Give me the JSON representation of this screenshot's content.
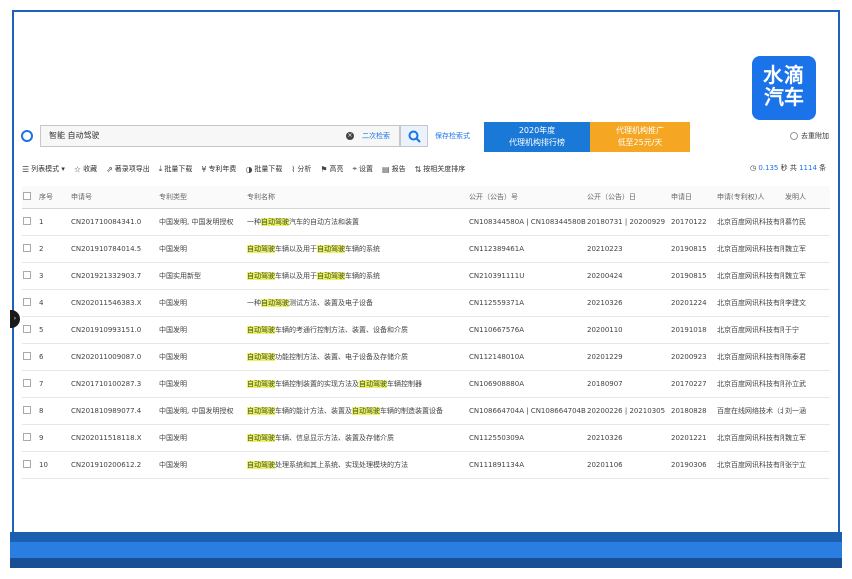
{
  "logo": {
    "line1": "水滴",
    "line2": "汽车"
  },
  "search": {
    "query": "智能 自动驾驶",
    "secondary_search_label": "二次检索",
    "save_label": "保存检索式"
  },
  "banner": {
    "left_line1": "2020年度",
    "left_line2": "代理机构排行榜",
    "right_line1": "代理机构推广",
    "right_line2": "低至25元/天"
  },
  "family_dedup_label": "去重附加",
  "toolbar": {
    "items": [
      {
        "icon": "list-icon",
        "label": "列表模式 ▾"
      },
      {
        "icon": "star-icon",
        "label": "收藏"
      },
      {
        "icon": "share-icon",
        "label": "著录项导出"
      },
      {
        "icon": "download-icon",
        "label": "批量下载"
      },
      {
        "icon": "yen-icon",
        "label": "专利年费"
      },
      {
        "icon": "contrast-icon",
        "label": "批量下载"
      },
      {
        "icon": "chart-icon",
        "label": "分析"
      },
      {
        "icon": "flag-icon",
        "label": "高亮"
      },
      {
        "icon": "pin-icon",
        "label": "设置"
      },
      {
        "icon": "report-icon",
        "label": "报告"
      },
      {
        "icon": "sort-icon",
        "label": "按相关度排序"
      }
    ]
  },
  "stats": {
    "time": "0.135",
    "time_unit": "秒 共",
    "count": "1114",
    "count_unit": "条"
  },
  "table": {
    "headers": [
      "序号",
      "申请号",
      "专利类型",
      "专利名称",
      "公开（公告）号",
      "公开（公告）日",
      "申请日",
      "申请(专利权)人",
      "发明人"
    ],
    "rows": [
      {
        "no": "1",
        "appno": "CN201710084341.0",
        "type": "中国发明, 中国发明授权",
        "title_parts": [
          {
            "t": "一种"
          },
          {
            "t": "自动驾驶",
            "h": true
          },
          {
            "t": "汽车的自动方法和装置"
          }
        ],
        "pubno": "CN108344580A | CN108344580B",
        "pubdate": "20180731 | 20200929",
        "appdate": "20170122",
        "applicant": "北京百度网讯科技有限公司",
        "inventor": "慕竹民"
      },
      {
        "no": "2",
        "appno": "CN201910784014.5",
        "type": "中国发明",
        "title_parts": [
          {
            "t": "自动驾驶",
            "h": true
          },
          {
            "t": "车辆以及用于"
          },
          {
            "t": "自动驾驶",
            "h": true
          },
          {
            "t": "车辆的系统"
          }
        ],
        "pubno": "CN112389461A",
        "pubdate": "20210223",
        "appdate": "20190815",
        "applicant": "北京百度网讯科技有限公司",
        "inventor": "魏立军"
      },
      {
        "no": "3",
        "appno": "CN201921332903.7",
        "type": "中国实用新型",
        "title_parts": [
          {
            "t": "自动驾驶",
            "h": true
          },
          {
            "t": "车辆以及用于"
          },
          {
            "t": "自动驾驶",
            "h": true
          },
          {
            "t": "车辆的系统"
          }
        ],
        "pubno": "CN210391111U",
        "pubdate": "20200424",
        "appdate": "20190815",
        "applicant": "北京百度网讯科技有限公司",
        "inventor": "魏立军"
      },
      {
        "no": "4",
        "appno": "CN202011546383.X",
        "type": "中国发明",
        "title_parts": [
          {
            "t": "一种"
          },
          {
            "t": "自动驾驶",
            "h": true
          },
          {
            "t": "测试方法、装置及电子设备"
          }
        ],
        "pubno": "CN112559371A",
        "pubdate": "20210326",
        "appdate": "20201224",
        "applicant": "北京百度网讯科技有限公司",
        "inventor": "李建文"
      },
      {
        "no": "5",
        "appno": "CN201910993151.0",
        "type": "中国发明",
        "title_parts": [
          {
            "t": "自动驾驶",
            "h": true
          },
          {
            "t": "车辆的考通行控制方法、装置、设备和介质"
          }
        ],
        "pubno": "CN110667576A",
        "pubdate": "20200110",
        "appdate": "20191018",
        "applicant": "北京百度网讯科技有限公司",
        "inventor": "于宁"
      },
      {
        "no": "6",
        "appno": "CN202011009087.0",
        "type": "中国发明",
        "title_parts": [
          {
            "t": "自动驾驶",
            "h": true
          },
          {
            "t": "功能控制方法、装置、电子设备及存储介质"
          }
        ],
        "pubno": "CN112148010A",
        "pubdate": "20201229",
        "appdate": "20200923",
        "applicant": "北京百度网讯科技有限公司",
        "inventor": "陈泰君"
      },
      {
        "no": "7",
        "appno": "CN201710100287.3",
        "type": "中国发明",
        "title_parts": [
          {
            "t": "自动驾驶",
            "h": true
          },
          {
            "t": "车辆控制装置的实现方法及"
          },
          {
            "t": "自动驾驶",
            "h": true
          },
          {
            "t": "车辆控制器"
          }
        ],
        "pubno": "CN106908880A",
        "pubdate": "20180907",
        "appdate": "20170227",
        "applicant": "北京百度网讯科技有限公司",
        "inventor": "孙立武"
      },
      {
        "no": "8",
        "appno": "CN201810989077.4",
        "type": "中国发明, 中国发明授权",
        "title_parts": [
          {
            "t": "自动驾驶",
            "h": true
          },
          {
            "t": "车辆的能计方法、装置及"
          },
          {
            "t": "自动驾驶",
            "h": true
          },
          {
            "t": "车辆的制造装置设备"
          }
        ],
        "pubno": "CN108664704A | CN108664704B",
        "pubdate": "20200226 | 20210305",
        "appdate": "20180828",
        "applicant": "百度在线网络技术（北京）有限公司",
        "inventor": "刘一涵"
      },
      {
        "no": "9",
        "appno": "CN202011518118.X",
        "type": "中国发明",
        "title_parts": [
          {
            "t": "自动驾驶",
            "h": true
          },
          {
            "t": "车辆、信息显示方法、装置及存储介质"
          }
        ],
        "pubno": "CN112550309A",
        "pubdate": "20210326",
        "appdate": "20201221",
        "applicant": "北京百度网讯科技有限公司",
        "inventor": "魏立军"
      },
      {
        "no": "10",
        "appno": "CN201910200612.2",
        "type": "中国发明",
        "title_parts": [
          {
            "t": "自动驾驶",
            "h": true
          },
          {
            "t": "处理系统和其上系统、实现处理模块的方法"
          }
        ],
        "pubno": "CN111891134A",
        "pubdate": "20201106",
        "appdate": "20190306",
        "applicant": "北京百度网讯科技有限公司",
        "inventor": "张宁立"
      }
    ]
  },
  "colors": {
    "accent": "#1a73e8",
    "highlight": "#e8f45a",
    "frame": "#1f63b8"
  }
}
